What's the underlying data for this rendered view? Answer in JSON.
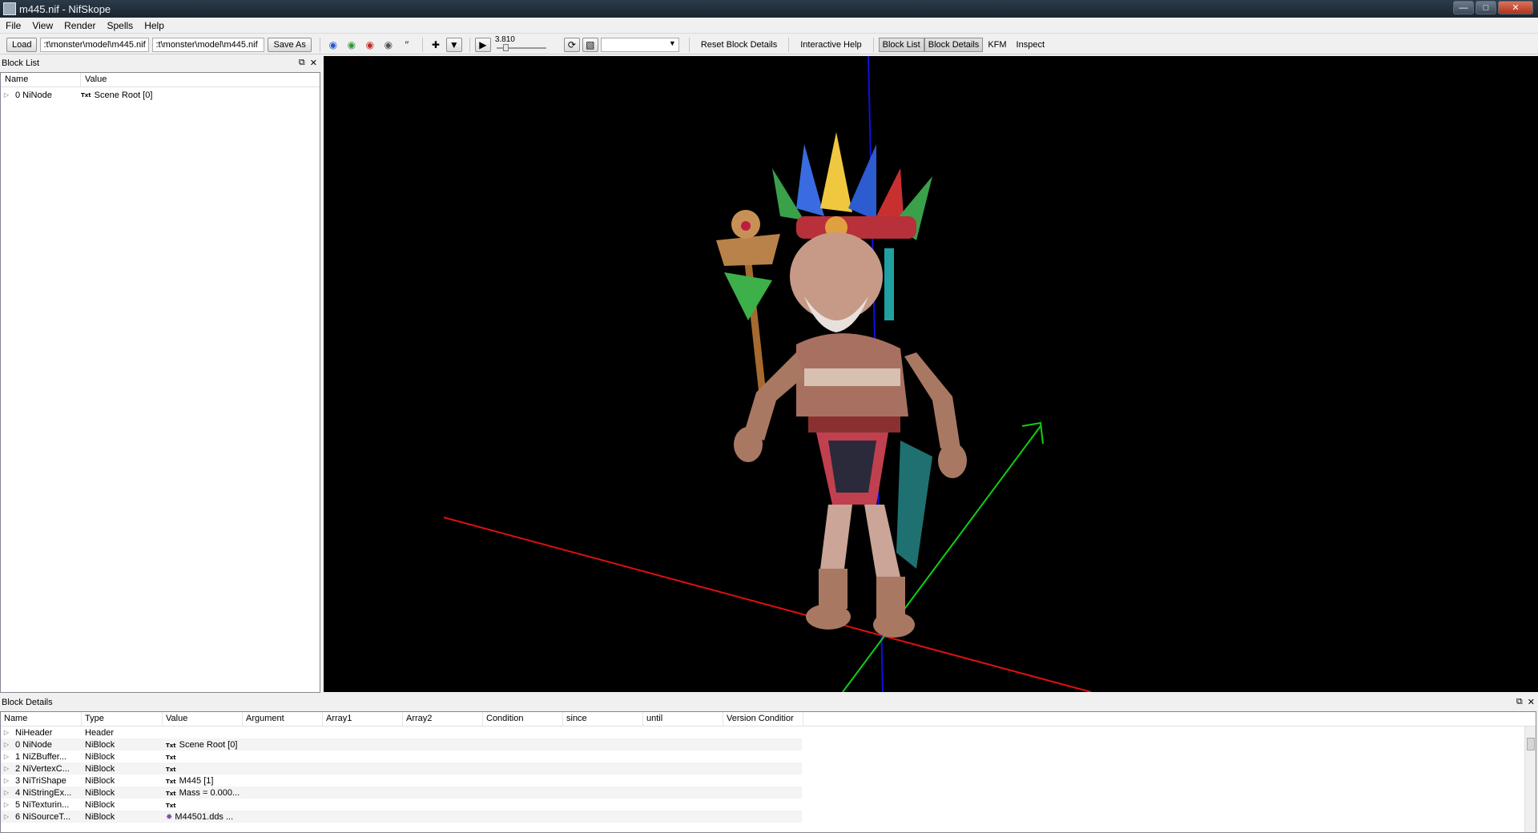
{
  "window": {
    "title": "m445.nif - NifSkope"
  },
  "menu": [
    "File",
    "View",
    "Render",
    "Spells",
    "Help"
  ],
  "toolbar": {
    "load_label": "Load",
    "load_path": ":t\\monster\\model\\m445.nif",
    "save_path": ":t\\monster\\model\\m445.nif",
    "save_as_label": "Save As",
    "time_value": "3.810",
    "reset_block_details": "Reset Block Details",
    "interactive_help": "Interactive Help",
    "block_list": "Block List",
    "block_details": "Block Details",
    "kfm": "KFM",
    "inspect": "Inspect"
  },
  "block_list": {
    "title": "Block List",
    "columns": [
      "Name",
      "Value"
    ],
    "rows": [
      {
        "name": "0 NiNode",
        "value": "Scene Root [0]"
      }
    ]
  },
  "block_details": {
    "title": "Block Details",
    "columns": [
      "Name",
      "Type",
      "Value",
      "Argument",
      "Array1",
      "Array2",
      "Condition",
      "since",
      "until",
      "Version Conditior"
    ],
    "rows": [
      {
        "name": "NiHeader",
        "type": "Header",
        "value": "",
        "icon": ""
      },
      {
        "name": "0 NiNode",
        "type": "NiBlock",
        "value": "Scene Root [0]",
        "icon": "Txt"
      },
      {
        "name": "1 NiZBuffer...",
        "type": "NiBlock",
        "value": "",
        "icon": "Txt"
      },
      {
        "name": "2 NiVertexC...",
        "type": "NiBlock",
        "value": "",
        "icon": "Txt"
      },
      {
        "name": "3 NiTriShape",
        "type": "NiBlock",
        "value": "M445 [1]",
        "icon": "Txt"
      },
      {
        "name": "4 NiStringEx...",
        "type": "NiBlock",
        "value": "Mass = 0.000...",
        "icon": "Txt"
      },
      {
        "name": "5 NiTexturin...",
        "type": "NiBlock",
        "value": "",
        "icon": "Txt"
      },
      {
        "name": "6 NiSourceT...",
        "type": "NiBlock",
        "value": "M44501.dds ...",
        "icon": "texture"
      }
    ]
  },
  "colors": {
    "viewport_bg": "#000000",
    "axis_x": "#e01010",
    "axis_y": "#1010e0",
    "axis_z": "#10d010"
  }
}
